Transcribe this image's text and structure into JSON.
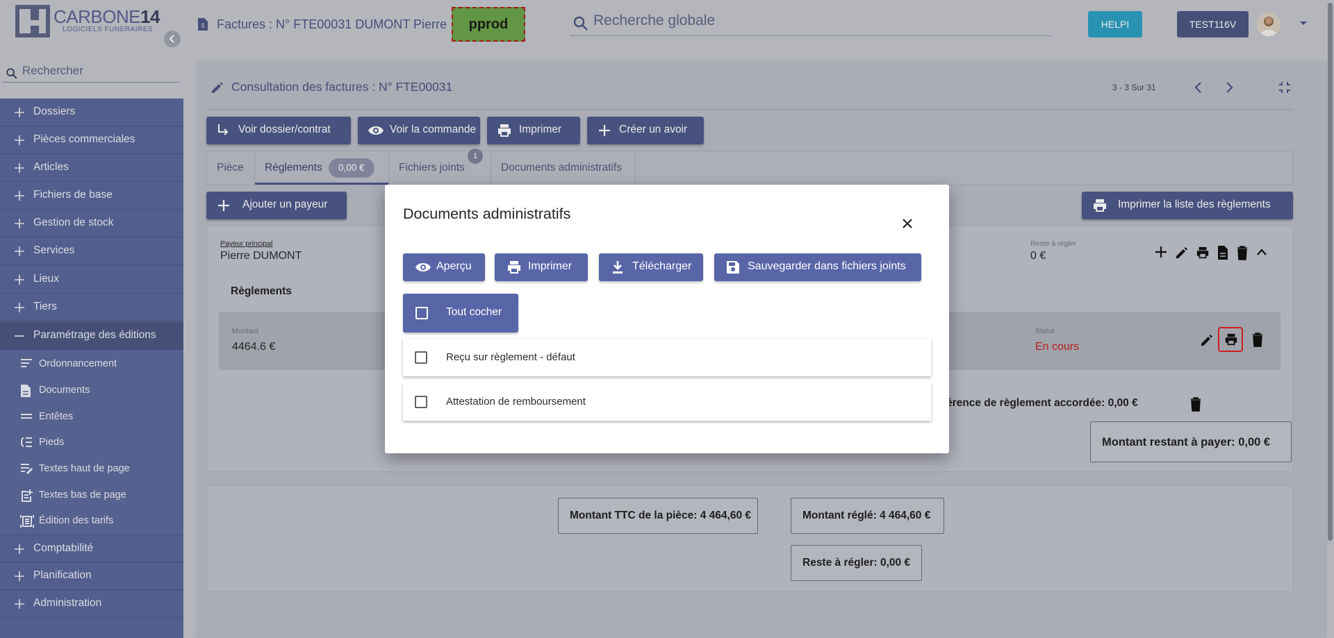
{
  "brand": {
    "name_part1": "CARBONE",
    "name_part2": "14",
    "tagline": "LOGICIELS FUNERAIRES"
  },
  "sidebar": {
    "search_placeholder": "Rechercher",
    "items": [
      {
        "label": "Dossiers"
      },
      {
        "label": "Pièces commerciales"
      },
      {
        "label": "Articles"
      },
      {
        "label": "Fichiers de base"
      },
      {
        "label": "Gestion de stock"
      },
      {
        "label": "Services"
      },
      {
        "label": "Lieux"
      },
      {
        "label": "Tiers"
      },
      {
        "label": "Paramétrage des éditions"
      },
      {
        "label": "Comptabilité"
      },
      {
        "label": "Planification"
      },
      {
        "label": "Administration"
      }
    ],
    "subitems": [
      {
        "label": "Ordonnancement",
        "icon": "sort-lines-icon"
      },
      {
        "label": "Documents",
        "icon": "document-icon"
      },
      {
        "label": "Entêtes",
        "icon": "header-lines-icon"
      },
      {
        "label": "Pieds",
        "icon": "footer-icon"
      },
      {
        "label": "Textes haut de page",
        "icon": "edit-lines-icon"
      },
      {
        "label": "Textes bas de page",
        "icon": "post-add-icon"
      },
      {
        "label": "Édition des tarifs",
        "icon": "receipt-icon"
      }
    ]
  },
  "header": {
    "doc_title": "Factures : N° FTE00031 DUMONT Pierre",
    "env_badge": "pprod",
    "global_search_placeholder": "Recherche globale",
    "helpi_label": "HELPI",
    "user_label": "TEST116V"
  },
  "panel": {
    "title": "Consultation des factures : N° FTE00031",
    "pager": "3 - 3 Sur 31",
    "actions": {
      "voir_dossier": "Voir dossier/contrat",
      "voir_commande": "Voir la commande",
      "imprimer": "Imprimer",
      "creer_avoir": "Créer un avoir"
    },
    "tabs": {
      "piece": "Pièce",
      "reglements": "Règlements",
      "reglements_amount": "0,00 €",
      "fichiers": "Fichiers joints",
      "fichiers_badge": "1",
      "documents": "Documents administratifs"
    },
    "ajouter_payeur": "Ajouter un payeur",
    "imprimer_liste": "Imprimer la liste des règlements",
    "payeur": {
      "label": "Payeur principal",
      "name": "Pierre DUMONT",
      "reste_label": "Reste à régler",
      "reste_value": "0 €"
    },
    "reglements_heading": "Règlements",
    "reglement_row": {
      "montant_label": "Montant",
      "montant_value": "4464.6 €",
      "statut_label": "Statut",
      "statut_value": "En cours"
    },
    "difference_text": "érence de règlement accordée:  0,00 €",
    "montant_restant": "Montant restant à payer:  0,00 €",
    "totals": {
      "ttc": "Montant TTC de la pièce:  4 464,60 €",
      "regle": "Montant réglé:  4 464,60 €",
      "reste": "Reste à régler:  0,00 €"
    }
  },
  "modal": {
    "title": "Documents administratifs",
    "buttons": {
      "apercu": "Aperçu",
      "imprimer": "Imprimer",
      "telecharger": "Télécharger",
      "sauvegarder": "Sauvegarder dans fichiers joints"
    },
    "tout_cocher": "Tout cocher",
    "documents": [
      {
        "label": "Reçu sur règlement - défaut",
        "checked": false
      },
      {
        "label": "Attestation de remboursement",
        "checked": false
      }
    ]
  },
  "colors": {
    "sidebar_bg": "#5a6799",
    "primary_button": "#4f5a8a",
    "modal_button": "#5866a8",
    "env_badge_bg": "#6ba24a",
    "helpi": "#2d9fc3",
    "status_red": "#c8201e"
  }
}
